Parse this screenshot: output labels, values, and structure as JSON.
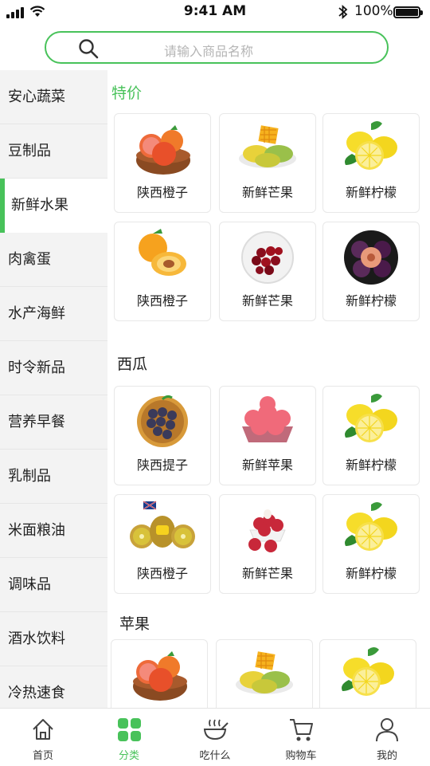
{
  "status_bar": {
    "time": "9:41 AM",
    "battery_percent": "100%",
    "battery_level": 1.0
  },
  "search": {
    "placeholder": "请输入商品名称"
  },
  "sidebar": {
    "active_index": 2,
    "items": [
      {
        "label": "安心蔬菜"
      },
      {
        "label": "豆制品"
      },
      {
        "label": "新鲜水果"
      },
      {
        "label": "肉禽蛋"
      },
      {
        "label": "水产海鲜"
      },
      {
        "label": "时令新品"
      },
      {
        "label": "营养早餐"
      },
      {
        "label": "乳制品"
      },
      {
        "label": "米面粮油"
      },
      {
        "label": "调味品"
      },
      {
        "label": "酒水饮料"
      },
      {
        "label": "冷热速食"
      }
    ]
  },
  "sections": [
    {
      "title": "特价",
      "products": [
        {
          "name": "陕西橙子",
          "icon": "grapefruit-bowl-icon"
        },
        {
          "name": "新鲜芒果",
          "icon": "mango-icon"
        },
        {
          "name": "新鲜柠檬",
          "icon": "lemon-icon"
        },
        {
          "name": "陕西橙子",
          "icon": "apricot-icon"
        },
        {
          "name": "新鲜芒果",
          "icon": "cherry-plate-icon"
        },
        {
          "name": "新鲜柠檬",
          "icon": "plum-icon"
        }
      ]
    },
    {
      "title": "西瓜",
      "products": [
        {
          "name": "陕西提子",
          "icon": "grape-basket-icon"
        },
        {
          "name": "新鲜苹果",
          "icon": "apple-basket-icon"
        },
        {
          "name": "新鲜柠檬",
          "icon": "lemon-icon"
        },
        {
          "name": "陕西橙子",
          "icon": "kiwi-icon"
        },
        {
          "name": "新鲜芒果",
          "icon": "lychee-icon"
        },
        {
          "name": "新鲜柠檬",
          "icon": "lemon-icon"
        }
      ]
    },
    {
      "title": "苹果",
      "products": [
        {
          "name": "",
          "icon": "grapefruit-bowl-icon"
        },
        {
          "name": "",
          "icon": "mango-icon"
        },
        {
          "name": "",
          "icon": "lemon-icon"
        }
      ]
    }
  ],
  "tabbar": {
    "active_index": 1,
    "items": [
      {
        "label": "首页",
        "icon": "home-icon"
      },
      {
        "label": "分类",
        "icon": "category-grid-icon"
      },
      {
        "label": "吃什么",
        "icon": "food-bowl-icon"
      },
      {
        "label": "购物车",
        "icon": "cart-icon"
      },
      {
        "label": "我的",
        "icon": "profile-icon"
      }
    ]
  },
  "colors": {
    "accent": "#48c25a",
    "sidebar_bg": "#f3f3f3"
  }
}
